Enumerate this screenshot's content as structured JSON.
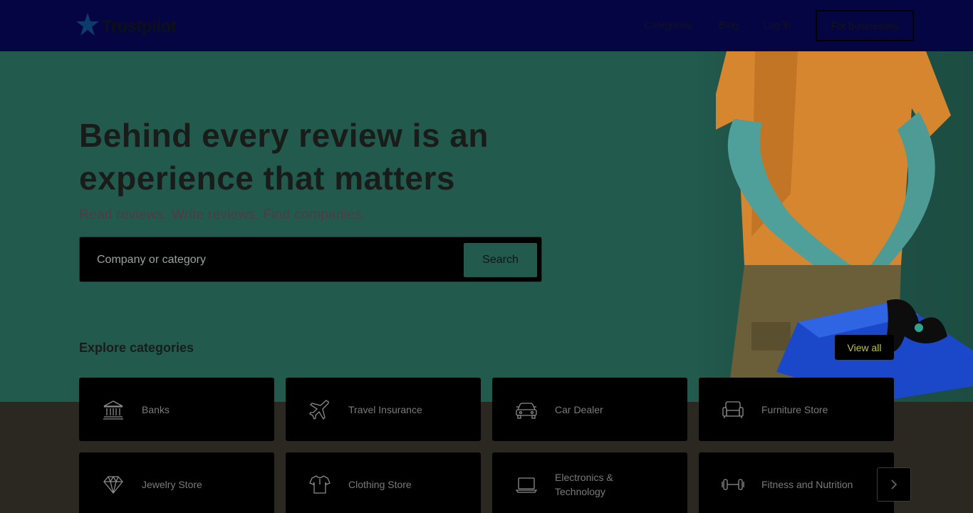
{
  "header": {
    "logo_text": "Trustpilot",
    "nav": [
      "Categories",
      "Blog",
      "Log in"
    ],
    "business_button": "For businesses"
  },
  "hero": {
    "headline": "Behind every review is an experience that matters",
    "subheadline": "Read reviews. Write reviews. Find companies.",
    "search": {
      "placeholder": "Company or category",
      "button": "Search"
    }
  },
  "categories": {
    "title": "Explore categories",
    "view_all": "View all",
    "items": [
      {
        "label": "Banks",
        "icon": "bank-icon"
      },
      {
        "label": "Travel Insurance",
        "icon": "airplane-icon"
      },
      {
        "label": "Car Dealer",
        "icon": "car-icon"
      },
      {
        "label": "Furniture Store",
        "icon": "armchair-icon"
      },
      {
        "label": "Jewelry Store",
        "icon": "diamond-icon"
      },
      {
        "label": "Clothing Store",
        "icon": "shirt-icon"
      },
      {
        "label": "Electronics & Technology",
        "icon": "laptop-icon"
      },
      {
        "label": "Fitness and Nutrition",
        "icon": "dumbbell-icon"
      }
    ],
    "next_icon": "chevron-right-icon"
  },
  "colors": {
    "header_bg": "#050543",
    "hero_bg": "#225b4e",
    "page_bg": "#2a2820",
    "card_bg": "#000000",
    "logo_star": "#0e3b6e"
  }
}
